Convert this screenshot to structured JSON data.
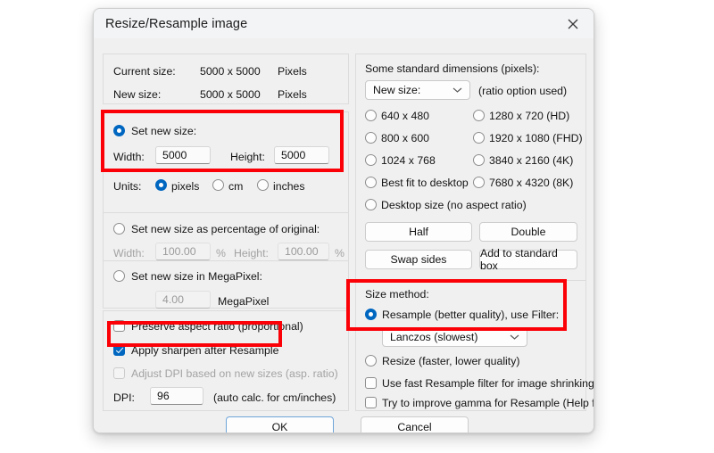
{
  "window": {
    "title": "Resize/Resample image",
    "close_icon": "close-icon"
  },
  "left_panel": {
    "info": {
      "current_size_label": "Current size:",
      "current_size_value": "5000  x  5000",
      "current_size_unit": "Pixels",
      "new_size_label": "New size:",
      "new_size_value": "5000  x  5000",
      "new_size_unit": "Pixels"
    },
    "set_new_size": {
      "radio_label": "Set new size:",
      "selected": true,
      "width_label": "Width:",
      "width_value": "5000",
      "height_label": "Height:",
      "height_value": "5000"
    },
    "units": {
      "label": "Units:",
      "options": [
        "pixels",
        "cm",
        "inches"
      ],
      "selected": "pixels"
    },
    "percentage": {
      "radio_label": "Set new size as percentage of original:",
      "selected": false,
      "width_label": "Width:",
      "width_value": "100.00",
      "width_unit": "%",
      "height_label": "Height:",
      "height_value": "100.00",
      "height_unit": "%"
    },
    "megapixel": {
      "radio_label": "Set new size in MegaPixel:",
      "selected": false,
      "value": "4.00",
      "unit": "MegaPixel"
    },
    "options": {
      "preserve_aspect_label": "Preserve aspect ratio (proportional)",
      "preserve_aspect_checked": false,
      "apply_sharpen_label": "Apply sharpen after Resample",
      "apply_sharpen_checked": true,
      "adjust_dpi_label": "Adjust DPI based on new sizes (asp. ratio)",
      "adjust_dpi_checked": false,
      "adjust_dpi_enabled": false,
      "dpi_label": "DPI:",
      "dpi_value": "96",
      "dpi_hint": "(auto calc. for cm/inches)"
    }
  },
  "right_panel": {
    "standard_dimensions": {
      "title": "Some standard dimensions (pixels):",
      "dropdown_value": "New size:",
      "dropdown_icon": "chevron-down-icon",
      "dropdown_hint": "(ratio option used)",
      "left_column": [
        "640 x 480",
        "800 x 600",
        "1024 x 768",
        "Best fit to desktop"
      ],
      "right_column": [
        "1280 x 720   (HD)",
        "1920 x 1080 (FHD)",
        "3840 x 2160 (4K)",
        "7680 x 4320 (8K)"
      ],
      "desktop_size_label": "Desktop size (no aspect ratio)",
      "buttons": {
        "half": "Half",
        "double": "Double",
        "swap_sides": "Swap sides",
        "add_to_standard_box": "Add to standard box"
      }
    },
    "size_method": {
      "title": "Size method:",
      "resample_label": "Resample (better quality), use Filter:",
      "resample_selected": true,
      "filter_value": "Lanczos (slowest)",
      "filter_icon": "chevron-down-icon",
      "resize_label": "Resize (faster, lower quality)",
      "resize_selected": false,
      "fast_filter_label": "Use fast Resample filter for image shrinking",
      "fast_filter_checked": false,
      "gamma_label": "Try to improve gamma for Resample (Help file",
      "gamma_checked": false
    }
  },
  "footer": {
    "ok_label": "OK",
    "cancel_label": "Cancel"
  },
  "annotations": {
    "highlight_color": "#fb0006",
    "boxes": [
      "set-new-size-highlight",
      "apply-sharpen-highlight",
      "resample-filter-highlight"
    ]
  }
}
